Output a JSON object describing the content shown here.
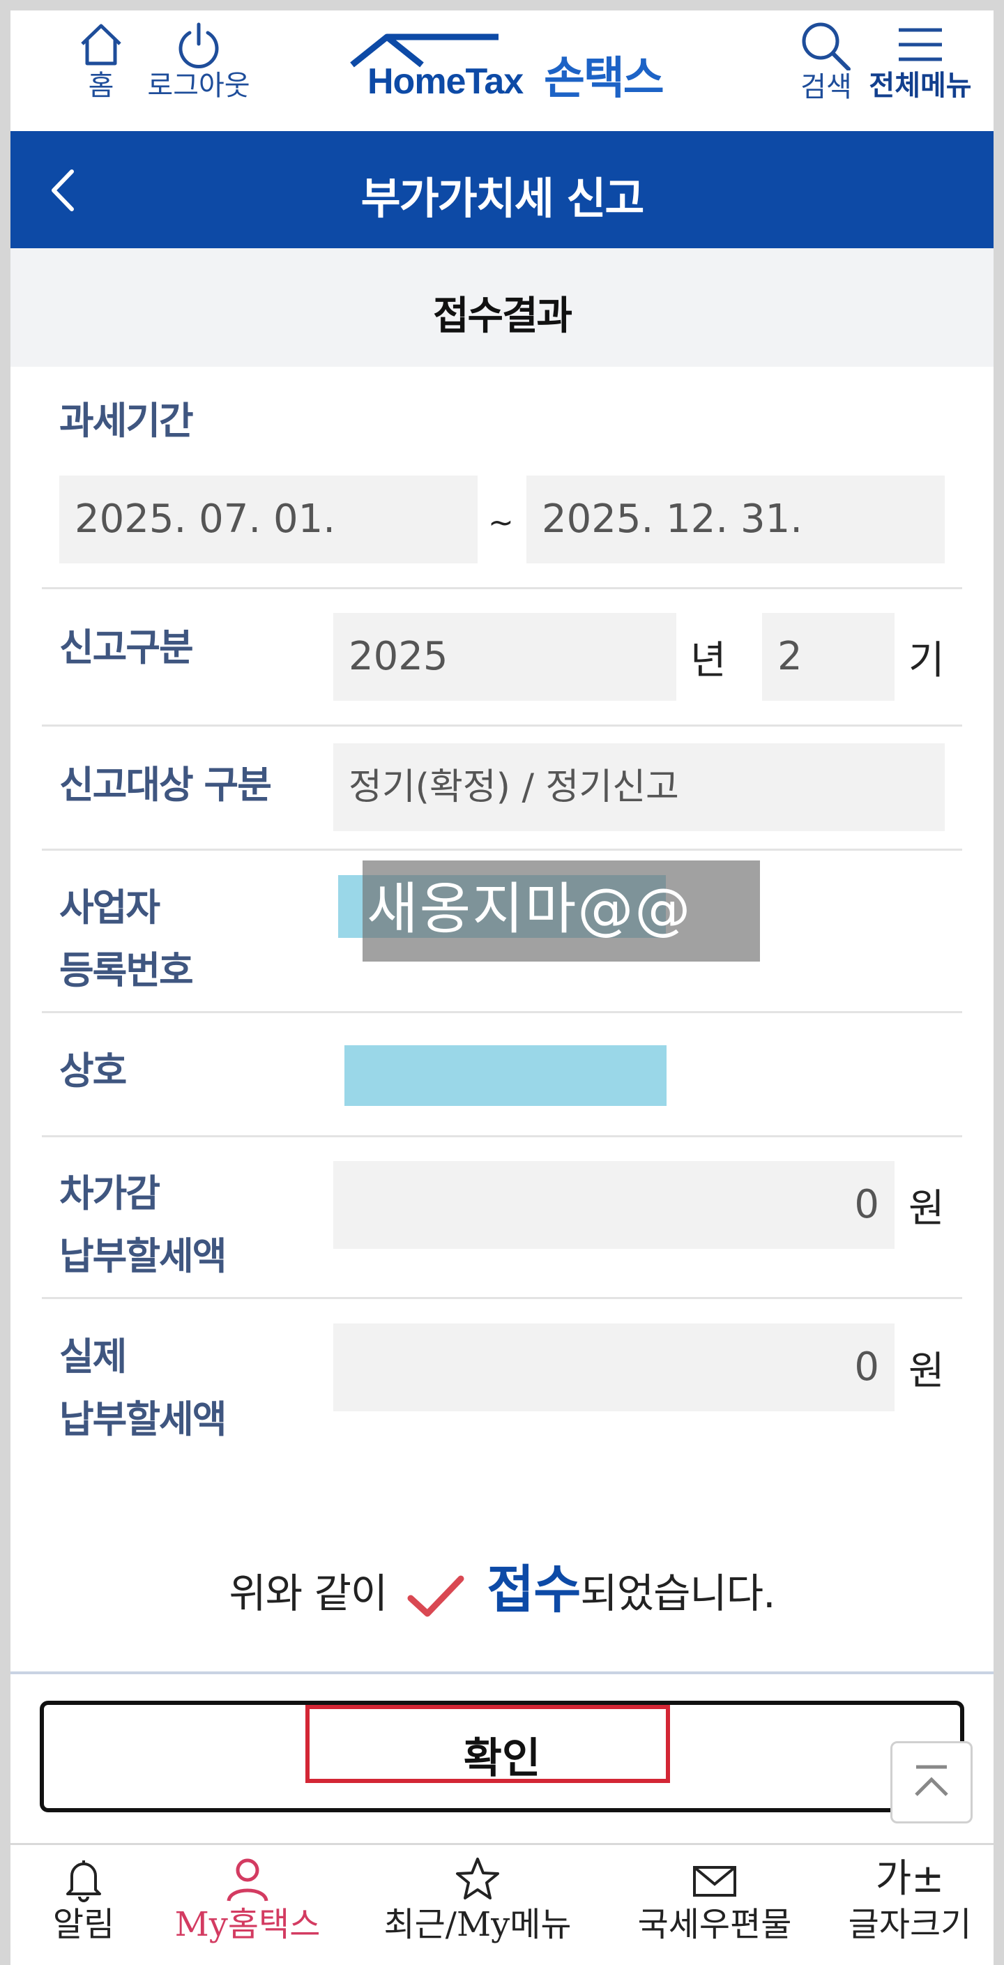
{
  "header": {
    "home_label": "홈",
    "logout_label": "로그아웃",
    "logo_text": "HomeTax",
    "logo_sub": "손택스",
    "search_label": "검색",
    "menu_label": "전체메뉴"
  },
  "titlebar": {
    "title": "부가가치세 신고"
  },
  "subheader": {
    "title": "접수결과"
  },
  "form": {
    "period_label": "과세기간",
    "period_start": "2025. 07. 01.",
    "period_tilde": "~",
    "period_end": "2025. 12. 31.",
    "report_type_label": "신고구분",
    "report_year": "2025",
    "year_unit": "년",
    "report_term": "2",
    "term_unit": "기",
    "target_label": "신고대상 구분",
    "target_value": "정기(확정) / 정기신고",
    "bizno_label_1": "사업자",
    "bizno_label_2": "등록번호",
    "watermark": "새옹지마@@",
    "company_label": "상호",
    "deduct_label_1": "차가감",
    "deduct_label_2": "납부할세액",
    "deduct_value": "0",
    "deduct_unit": "원",
    "actual_label_1": "실제",
    "actual_label_2": "납부할세액",
    "actual_value": "0",
    "actual_unit": "원"
  },
  "message": {
    "prefix": "위와 같이",
    "strong": "접수",
    "suffix": "되었습니다."
  },
  "confirm_button": "확인",
  "bottom_nav": {
    "alert": "알림",
    "my_hometax": "My홈택스",
    "recent": "최근/My메뉴",
    "post": "국세우편물",
    "font_icon": "가±",
    "font_size": "글자크기"
  },
  "colors": {
    "primary": "#0d4aa6",
    "accent_red": "#d32635",
    "my_pink": "#d33b61",
    "redact": "#9ad7e8"
  }
}
